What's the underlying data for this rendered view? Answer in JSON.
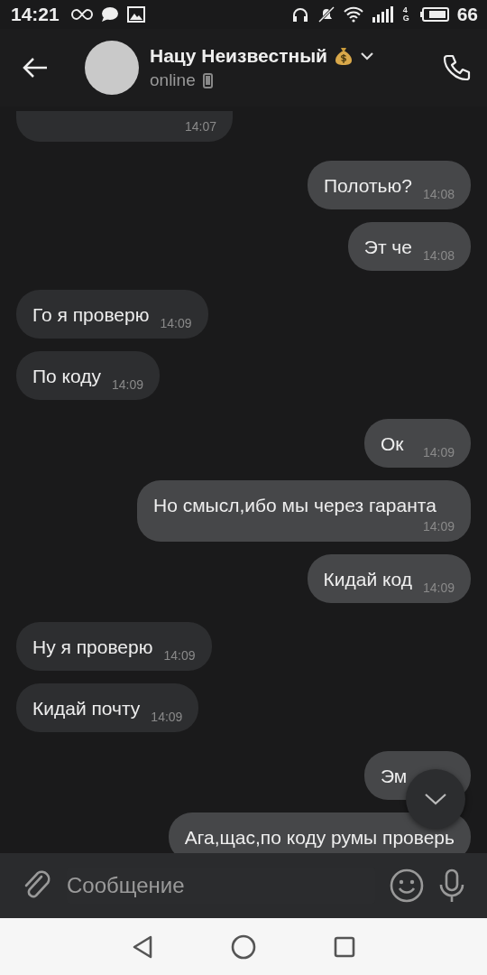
{
  "status_bar": {
    "time": "14:21",
    "network": "4G",
    "battery": "66"
  },
  "header": {
    "name": "Нацу Неизвестный",
    "status": "online"
  },
  "messages": [
    {
      "time": "14:07",
      "outgoing": false
    },
    {
      "text": "Полотью?",
      "time": "14:08",
      "outgoing": true
    },
    {
      "text": "Эт че",
      "time": "14:08",
      "outgoing": true
    },
    {
      "text": "Го я проверю",
      "time": "14:09",
      "outgoing": false
    },
    {
      "text": "По коду",
      "time": "14:09",
      "outgoing": false
    },
    {
      "text": "Ок",
      "time": "14:09",
      "outgoing": true
    },
    {
      "text": "Но смысл,ибо мы через гаранта",
      "time": "14:09",
      "outgoing": true
    },
    {
      "text": "Кидай код",
      "time": "14:09",
      "outgoing": true
    },
    {
      "text": "Ну я проверю",
      "time": "14:09",
      "outgoing": false
    },
    {
      "text": "Кидай почту",
      "time": "14:09",
      "outgoing": false
    },
    {
      "text": "Эм",
      "outgoing": true
    },
    {
      "text": "Ага,щас,по коду румы проверь",
      "outgoing": true
    }
  ],
  "composer": {
    "placeholder": "Сообщение"
  }
}
